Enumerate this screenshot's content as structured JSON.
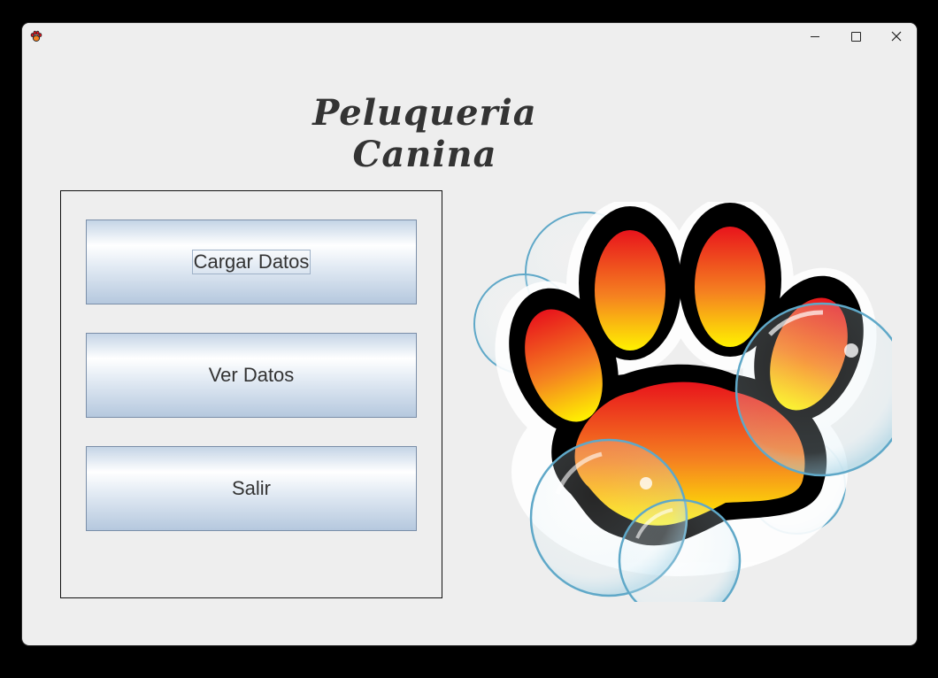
{
  "window": {
    "title": ""
  },
  "titlebar": {
    "icon": "paw-app-icon",
    "controls": [
      "minimize-icon",
      "maximize-icon",
      "close-icon"
    ]
  },
  "header": {
    "title": "Peluqueria Canina"
  },
  "menu": {
    "buttons": [
      {
        "label": "Cargar Datos",
        "focused": true
      },
      {
        "label": "Ver Datos",
        "focused": false
      },
      {
        "label": "Salir",
        "focused": false
      }
    ]
  },
  "illustration": {
    "name": "paw-with-bubbles-image"
  },
  "colors": {
    "window_bg": "#eeeeee",
    "button_gradient_top": "#c4d4e6",
    "button_gradient_bottom": "#b5c8de",
    "paw_outline": "#000000",
    "paw_red": "#e8141c",
    "paw_orange": "#f58220",
    "paw_yellow": "#fff200",
    "bubble_edge": "#5fa8c8"
  }
}
